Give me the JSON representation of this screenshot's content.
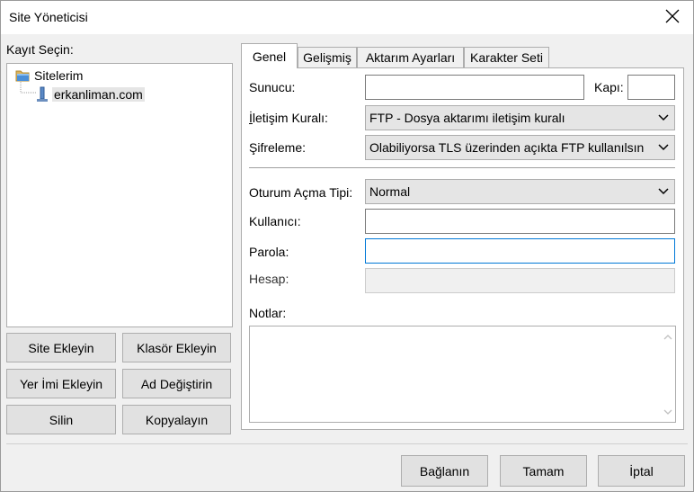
{
  "window": {
    "title": "Site Yöneticisi"
  },
  "left": {
    "select_label": "Kayıt Seçin:",
    "tree": {
      "root": "Sitelerim",
      "child": "erkanliman.com"
    },
    "buttons": {
      "new_site": "Site Ekleyin",
      "new_folder": "Klasör Ekleyin",
      "new_bookmark": "Yer İmi Ekleyin",
      "rename": "Ad Değiştirin",
      "delete": "Silin",
      "duplicate": "Kopyalayın"
    }
  },
  "tabs": [
    "Genel",
    "Gelişmiş",
    "Aktarım Ayarları",
    "Karakter Seti"
  ],
  "form": {
    "host_label": "Sunucu:",
    "host_value": "",
    "port_label": "Kapı:",
    "port_value": "",
    "protocol_label": "İletişim Kuralı:",
    "protocol_value": "FTP - Dosya aktarımı iletişim kuralı",
    "encryption_label": "Şifreleme:",
    "encryption_value": "Olabiliyorsa TLS üzerinden açıkta FTP kullanılsın",
    "logon_label": "Oturum Açma Tipi:",
    "logon_value": "Normal",
    "user_label": "Kullanıcı:",
    "user_value": "",
    "password_label": "Parola:",
    "password_value": "",
    "account_label": "Hesap:",
    "account_value": "",
    "notes_label": "Notlar:",
    "notes_value": ""
  },
  "footer": {
    "connect": "Bağlanın",
    "ok": "Tamam",
    "cancel": "İptal"
  }
}
